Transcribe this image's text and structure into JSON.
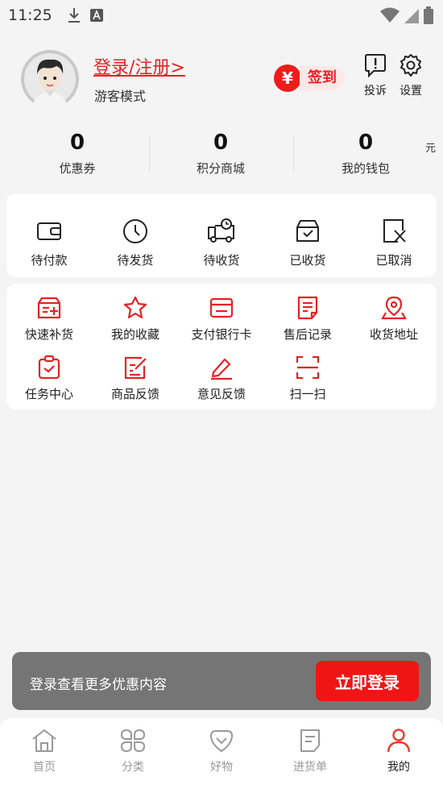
{
  "status_bar": {
    "time": "11:25"
  },
  "header": {
    "login_link": "登录/注册>",
    "guest_mode": "游客模式",
    "signin_symbol": "¥",
    "signin_label": "签到",
    "complaint_label": "投诉",
    "settings_label": "设置"
  },
  "stats": [
    {
      "value": "0",
      "label": "优惠券"
    },
    {
      "value": "0",
      "label": "积分商城"
    },
    {
      "value": "0",
      "label": "我的钱包"
    }
  ],
  "wallet_unit": "元",
  "orders": [
    {
      "label": "待付款",
      "icon": "wallet-icon"
    },
    {
      "label": "待发货",
      "icon": "clock-icon"
    },
    {
      "label": "待收货",
      "icon": "truck-icon"
    },
    {
      "label": "已收货",
      "icon": "box-check-icon"
    },
    {
      "label": "已取消",
      "icon": "cancel-icon"
    }
  ],
  "tools": [
    {
      "label": "快速补货",
      "icon": "restock-icon"
    },
    {
      "label": "我的收藏",
      "icon": "star-icon"
    },
    {
      "label": "支付银行卡",
      "icon": "bank-card-icon"
    },
    {
      "label": "售后记录",
      "icon": "document-icon"
    },
    {
      "label": "收货地址",
      "icon": "location-icon"
    },
    {
      "label": "任务中心",
      "icon": "clipboard-check-icon"
    },
    {
      "label": "商品反馈",
      "icon": "edit-icon"
    },
    {
      "label": "意见反馈",
      "icon": "pencil-icon"
    },
    {
      "label": "扫一扫",
      "icon": "scan-icon"
    }
  ],
  "login_banner": {
    "text": "登录查看更多优惠内容",
    "button": "立即登录"
  },
  "tabs": [
    {
      "label": "首页",
      "icon": "home-icon"
    },
    {
      "label": "分类",
      "icon": "category-icon"
    },
    {
      "label": "好物",
      "icon": "heart-shield-icon"
    },
    {
      "label": "进货单",
      "icon": "list-icon"
    },
    {
      "label": "我的",
      "icon": "person-icon",
      "active": true
    }
  ],
  "colors": {
    "accent": "#e52323",
    "banner_bg": "#757575",
    "page_bg": "#f4f4f4"
  }
}
